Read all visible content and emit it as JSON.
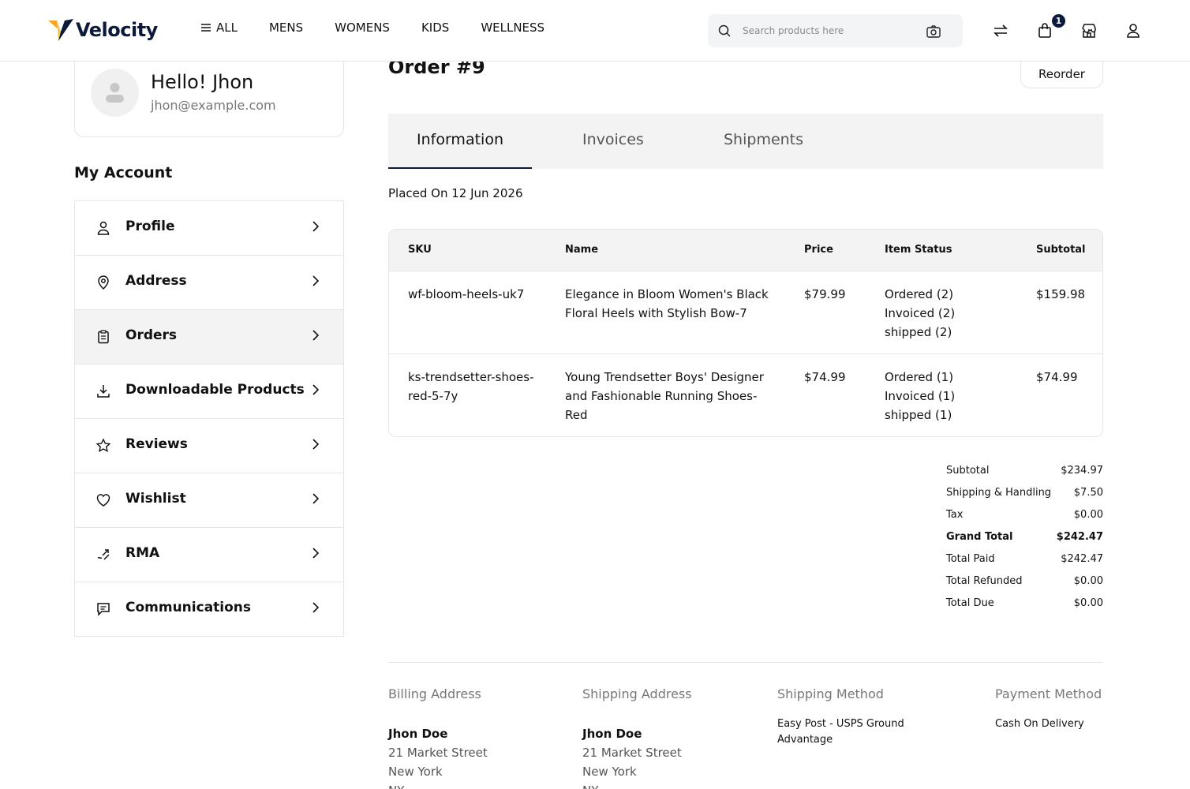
{
  "header": {
    "logo_text": "Velocity",
    "nav": [
      "ALL",
      "MENS",
      "WOMENS",
      "KIDS",
      "WELLNESS"
    ],
    "search_placeholder": "Search products here",
    "cart_count": "1",
    "accent": "#0b1a3a"
  },
  "sidebar": {
    "greeting": "Hello! Jhon",
    "email": "jhon@example.com",
    "section_title": "My Account",
    "items": [
      {
        "label": "Profile",
        "icon": "user-icon"
      },
      {
        "label": "Address",
        "icon": "location-icon"
      },
      {
        "label": "Orders",
        "icon": "orders-icon",
        "active": true
      },
      {
        "label": "Downloadable Products",
        "icon": "download-icon"
      },
      {
        "label": "Reviews",
        "icon": "star-icon"
      },
      {
        "label": "Wishlist",
        "icon": "heart-icon"
      },
      {
        "label": "RMA",
        "icon": "rma-icon"
      },
      {
        "label": "Communications",
        "icon": "chat-icon"
      }
    ]
  },
  "order": {
    "title": "Order #9",
    "reorder_label": "Reorder",
    "tabs": [
      "Information",
      "Invoices",
      "Shipments"
    ],
    "placed_on": "Placed On 12 Jun 2026",
    "columns": [
      "SKU",
      "Name",
      "Price",
      "Item Status",
      "Subtotal"
    ],
    "items": [
      {
        "sku": "wf-bloom-heels-uk7",
        "name": "Elegance in Bloom Women's Black Floral Heels with Stylish Bow-7",
        "price": "$79.99",
        "status": [
          "Ordered (2)",
          "Invoiced (2)",
          "shipped (2)"
        ],
        "subtotal": "$159.98"
      },
      {
        "sku": "ks-trendsetter-shoes-red-5-7y",
        "name": "Young Trendsetter Boys' Designer and Fashionable Running Shoes-Red",
        "price": "$74.99",
        "status": [
          "Ordered (1)",
          "Invoiced (1)",
          "shipped (1)"
        ],
        "subtotal": "$74.99"
      }
    ],
    "totals": [
      {
        "label": "Subtotal",
        "value": "$234.97"
      },
      {
        "label": "Shipping & Handling",
        "value": "$7.50"
      },
      {
        "label": "Tax",
        "value": "$0.00"
      },
      {
        "label": "Grand Total",
        "value": "$242.47",
        "bold": true
      },
      {
        "label": "Total Paid",
        "value": "$242.47"
      },
      {
        "label": "Total Refunded",
        "value": "$0.00"
      },
      {
        "label": "Total Due",
        "value": "$0.00"
      }
    ],
    "billing": {
      "heading": "Billing Address",
      "name": "Jhon Doe",
      "line1": "21 Market Street",
      "line2": "New York",
      "line3": "NY"
    },
    "shipping": {
      "heading": "Shipping Address",
      "name": "Jhon Doe",
      "line1": "21 Market Street",
      "line2": "New York",
      "line3": "NY"
    },
    "shipping_method": {
      "heading": "Shipping Method",
      "value": "Easy Post - USPS Ground Advantage"
    },
    "payment_method": {
      "heading": "Payment Method",
      "value": "Cash On Delivery"
    }
  }
}
